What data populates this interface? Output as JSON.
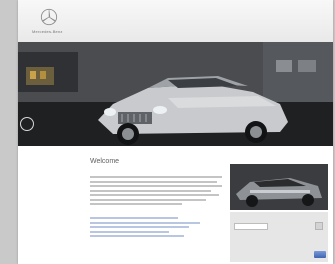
{
  "header": {
    "brand": "Mercedes-Benz",
    "topline": "",
    "top_links": [
      "",
      ""
    ],
    "nav": [
      "",
      "",
      "",
      "",
      ""
    ]
  },
  "hero": {
    "image": "silver-sedan-photo"
  },
  "main": {
    "welcome_title": "Welcome",
    "welcome_subtitle": ""
  },
  "sidebar": {
    "panel_title": "",
    "select_value": "",
    "note": "",
    "go_label": ""
  },
  "colors": {
    "page_bg": "#ffffff",
    "outer_bg": "#c9c9c9",
    "hero_dark": "#2c2d30",
    "link_blue": "#b9c6e2",
    "button_blue": "#3f63b2"
  }
}
